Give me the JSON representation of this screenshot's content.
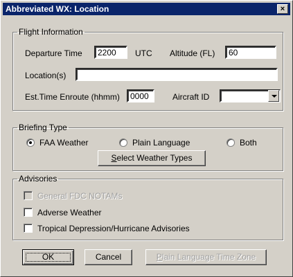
{
  "window": {
    "title": "Abbreviated WX: Location",
    "close_glyph": "×"
  },
  "flight": {
    "legend": "Flight Information",
    "departure_label": "Departure Time",
    "departure_value": "2200",
    "utc_label": "UTC",
    "altitude_label": "Altitude (FL)",
    "altitude_value": "60",
    "locations_label": "Location(s)",
    "locations_value": "",
    "ete_label": "Est.Time Enroute (hhmm)",
    "ete_value": "0000",
    "aircraft_label": "Aircraft ID",
    "aircraft_value": ""
  },
  "briefing": {
    "legend": "Briefing Type",
    "options": [
      "FAA Weather",
      "Plain Language",
      "Both"
    ],
    "selected": "FAA Weather",
    "select_button_first": "S",
    "select_button_rest": "elect Weather Types"
  },
  "advisories": {
    "legend": "Advisories",
    "items": [
      {
        "label": "General FDC NOTAMs",
        "checked": false,
        "enabled": false
      },
      {
        "label": "Adverse Weather",
        "checked": false,
        "enabled": true
      },
      {
        "label": "Tropical Depression/Hurricane Advisories",
        "checked": false,
        "enabled": true
      }
    ]
  },
  "buttons": {
    "ok_label": "OK",
    "cancel_label": "Cancel",
    "tz_first": "P",
    "tz_rest": "lain Language Time Zone"
  }
}
